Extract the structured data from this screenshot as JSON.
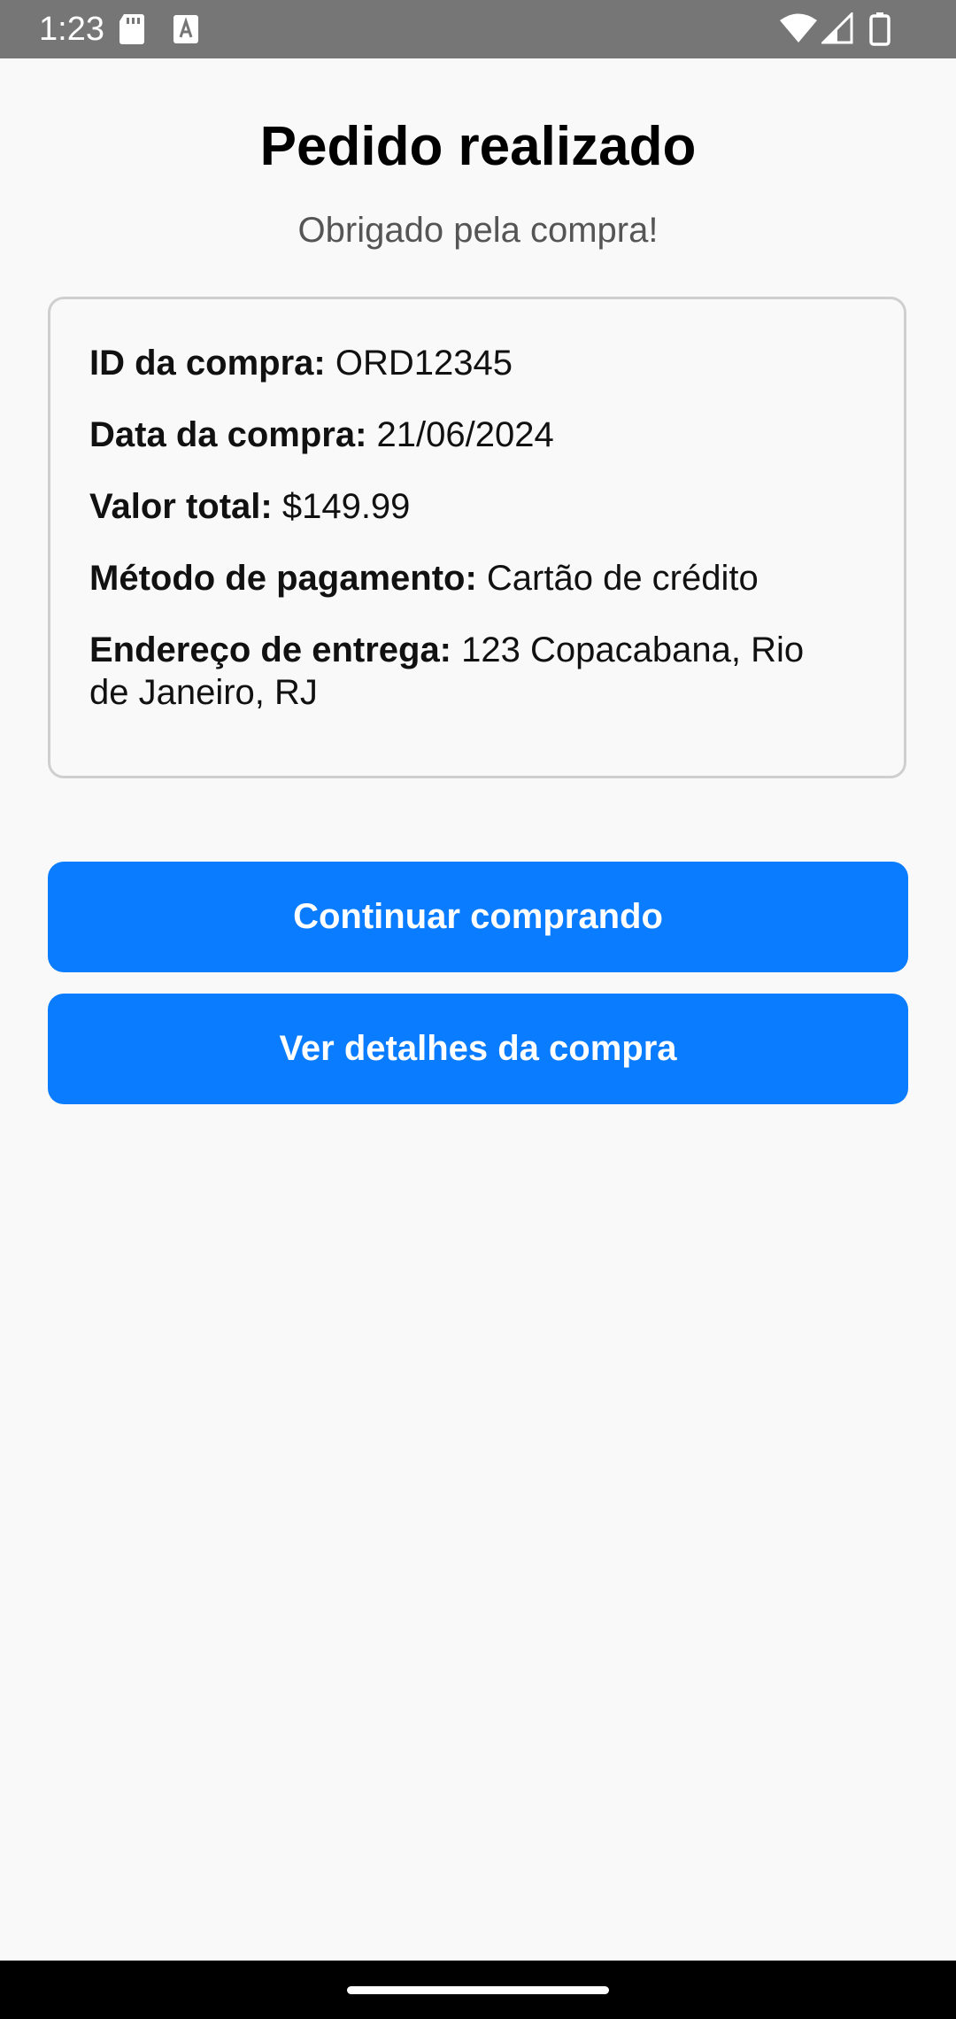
{
  "status_bar": {
    "time": "1:23",
    "icons": [
      "sd-card-icon",
      "a-icon",
      "wifi-icon",
      "signal-icon",
      "battery-icon"
    ]
  },
  "header": {
    "title": "Pedido realizado",
    "subtitle": "Obrigado pela compra!"
  },
  "order": {
    "id_label": "ID da compra:",
    "id_value": "ORD12345",
    "date_label": "Data da compra:",
    "date_value": "21/06/2024",
    "total_label": "Valor total:",
    "total_value": "$149.99",
    "payment_label": "Método de pagamento:",
    "payment_value": "Cartão de crédito",
    "address_label": "Endereço de entrega:",
    "address_value": "123 Copacabana, Rio de Janeiro, RJ"
  },
  "actions": {
    "continue_label": "Continuar comprando",
    "details_label": "Ver detalhes da compra"
  },
  "colors": {
    "primary": "#0a7cff",
    "background": "#f9f9f9",
    "status_bar": "#767676"
  }
}
